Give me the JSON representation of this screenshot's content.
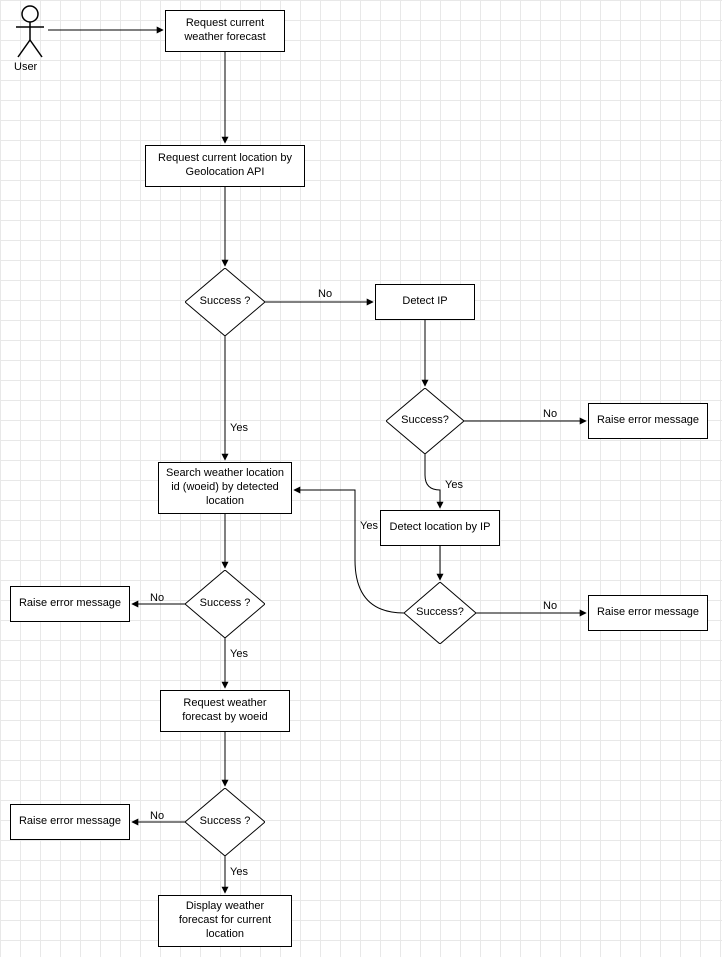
{
  "actor": {
    "label": "User"
  },
  "nodes": {
    "n1": "Request current weather forecast",
    "n2": "Request current location by Geolocation API",
    "d1": "Success ?",
    "n3": "Detect IP",
    "d2": "Success?",
    "n4": "Search weather location id (woeid) by detected location",
    "n5": "Detect location by IP",
    "d3": "Success?",
    "d4": "Success ?",
    "n6": "Raise error message",
    "n7": "Raise error message",
    "n8": "Raise error message",
    "n9": "Request weather forecast by woeid",
    "d5": "Success ?",
    "n10": "Raise error message",
    "n11": "Display weather forecast for current location"
  },
  "edgeLabels": {
    "d1_no": "No",
    "d1_yes": "Yes",
    "d2_no": "No",
    "d2_yes": "Yes",
    "d3_no": "No",
    "d3_yes": "Yes",
    "d4_no": "No",
    "d4_yes": "Yes",
    "d5_no": "No",
    "d5_yes": "Yes"
  },
  "diagram_description": "Flowchart describing the weather-forecast retrieval process starting from a user request. The flow attempts to get the current location via the Geolocation API; on failure it falls back to IP detection and IP-based location lookup. Once a location is available it searches for a weather location id (woeid), then requests and displays the weather forecast. Each decision point raises an error message on failure."
}
